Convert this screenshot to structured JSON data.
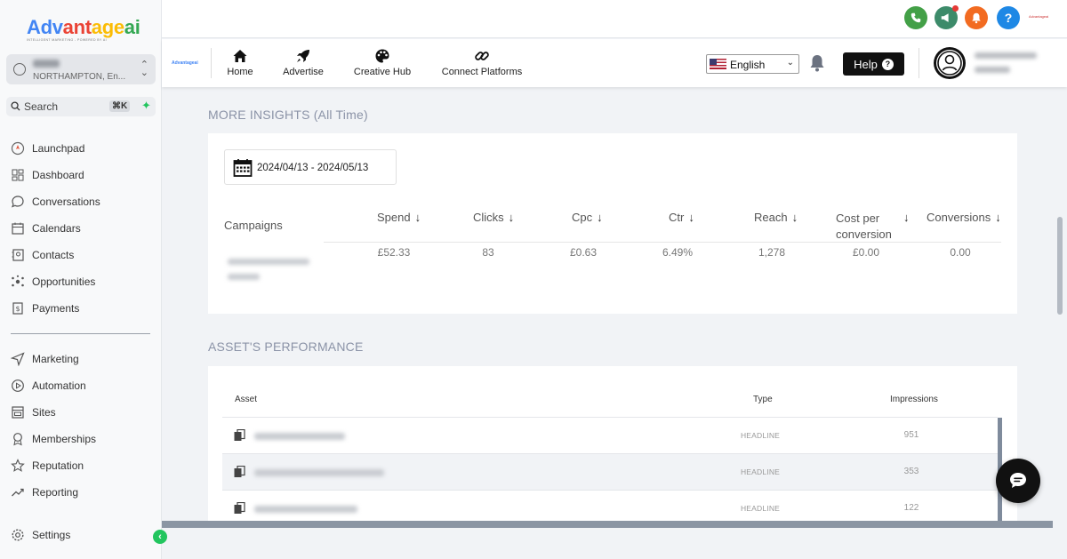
{
  "brand": {
    "logo_text": [
      "Adv",
      "ant",
      "age",
      "ai"
    ],
    "tagline": "INTELLIGENT MARKETING - POWERED BY AI"
  },
  "account": {
    "location": "NORTHAMPTON, En..."
  },
  "search": {
    "label": "Search",
    "shortcut": "⌘K"
  },
  "sidebar": {
    "items": [
      {
        "label": "Launchpad",
        "icon": "rocket-icon"
      },
      {
        "label": "Dashboard",
        "icon": "grid-icon"
      },
      {
        "label": "Conversations",
        "icon": "chat-icon"
      },
      {
        "label": "Calendars",
        "icon": "calendar-icon"
      },
      {
        "label": "Contacts",
        "icon": "contacts-icon"
      },
      {
        "label": "Opportunities",
        "icon": "network-icon"
      },
      {
        "label": "Payments",
        "icon": "receipt-icon"
      }
    ],
    "items2": [
      {
        "label": "Marketing",
        "icon": "send-icon"
      },
      {
        "label": "Automation",
        "icon": "play-circle-icon"
      },
      {
        "label": "Sites",
        "icon": "browser-icon"
      },
      {
        "label": "Memberships",
        "icon": "badge-icon"
      },
      {
        "label": "Reputation",
        "icon": "star-icon"
      },
      {
        "label": "Reporting",
        "icon": "trend-icon"
      }
    ],
    "settings": "Settings"
  },
  "topbar": {
    "buttons": [
      {
        "icon": "phone-icon",
        "color": "#43a047"
      },
      {
        "icon": "megaphone-icon",
        "color": "#3d8b6a"
      },
      {
        "icon": "bell-icon",
        "color": "#f26b21"
      },
      {
        "icon": "help-icon",
        "color": "#1e88e5"
      }
    ]
  },
  "appbar": {
    "nav": [
      {
        "label": "Home",
        "icon": "home-icon"
      },
      {
        "label": "Advertise",
        "icon": "rocket-icon"
      },
      {
        "label": "Creative Hub",
        "icon": "palette-icon"
      },
      {
        "label": "Connect Platforms",
        "icon": "link-icon"
      }
    ],
    "language": "English",
    "help": "Help",
    "help_q": "?"
  },
  "insights": {
    "title": "MORE INSIGHTS (All Time)",
    "date_range": "2024/04/13 - 2024/05/13",
    "columns": [
      "Campaigns",
      "Spend",
      "Clicks",
      "Cpc",
      "Ctr",
      "Reach",
      "Cost per conversion",
      "Conversions"
    ],
    "column_lines": {
      "cpc1": "Cost per",
      "cpc2": "conversion"
    },
    "row": {
      "spend": "£52.33",
      "clicks": "83",
      "cpc": "£0.63",
      "ctr": "6.49%",
      "reach": "1,278",
      "cost_per_conversion": "£0.00",
      "conversions": "0.00"
    }
  },
  "assets": {
    "title": "ASSET'S PERFORMANCE",
    "columns": [
      "Asset",
      "Type",
      "Impressions"
    ],
    "rows": [
      {
        "type": "HEADLINE",
        "impressions": "951"
      },
      {
        "type": "HEADLINE",
        "impressions": "353"
      },
      {
        "type": "HEADLINE",
        "impressions": "122"
      }
    ]
  }
}
